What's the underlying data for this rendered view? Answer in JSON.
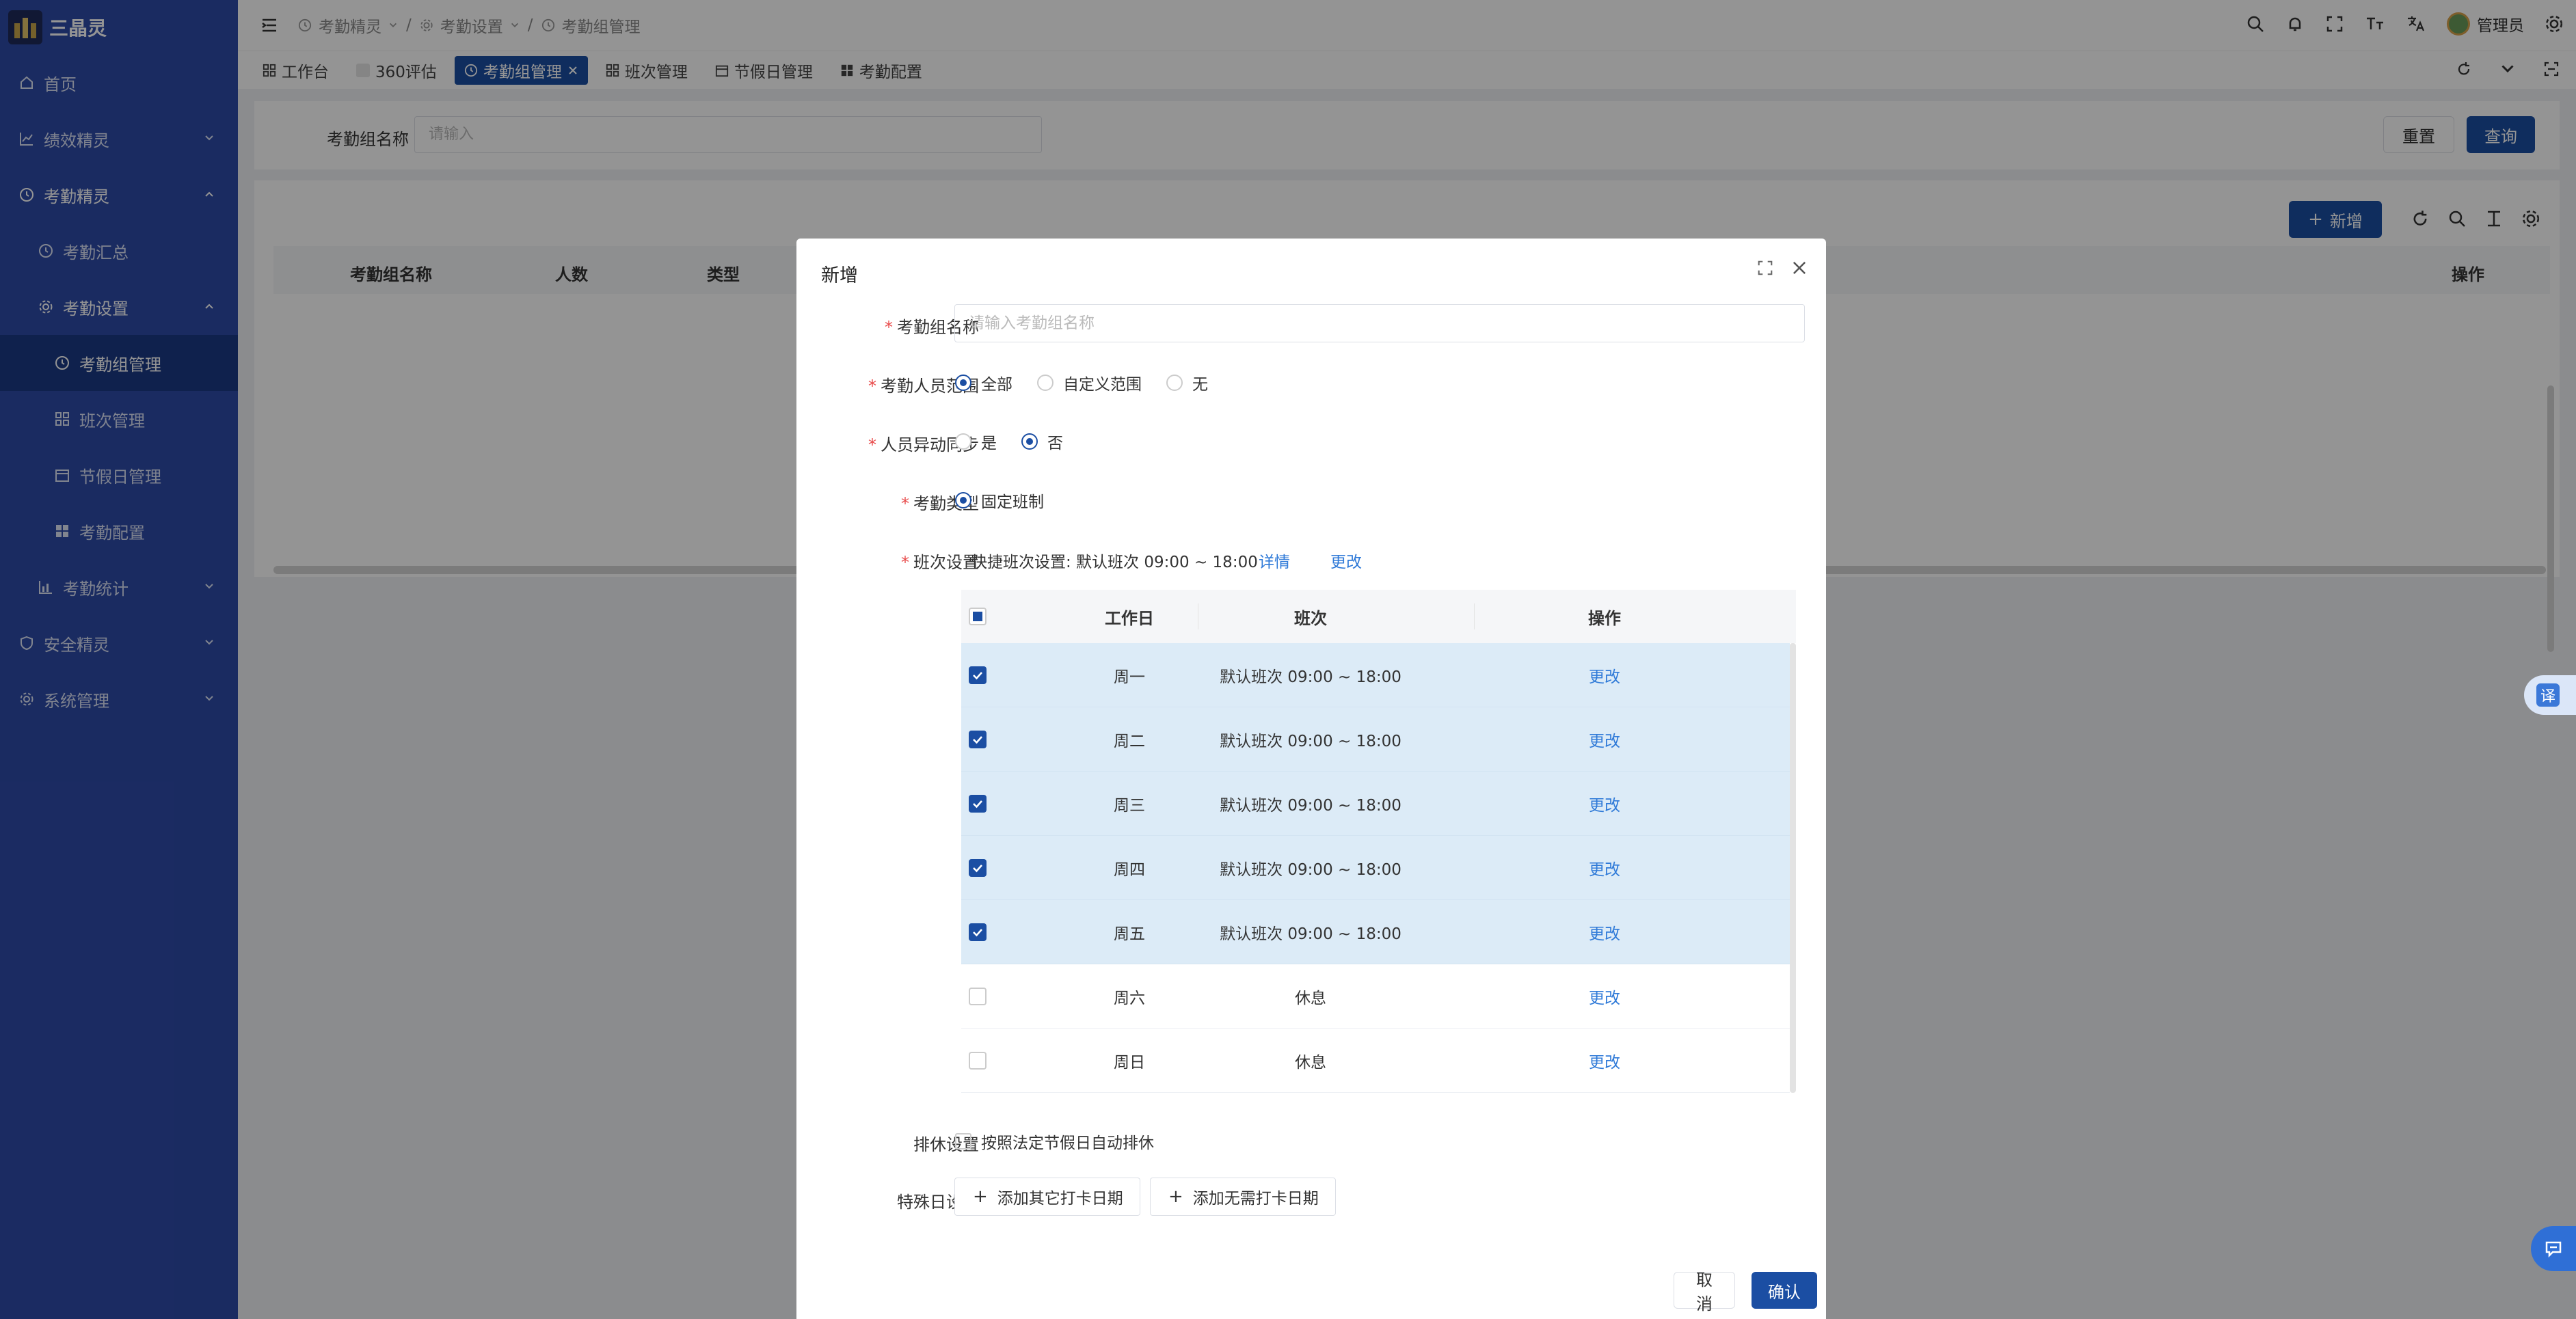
{
  "app": {
    "name": "三晶灵"
  },
  "sidebar": {
    "items": [
      {
        "label": "首页"
      },
      {
        "label": "绩效精灵"
      },
      {
        "label": "考勤精灵"
      },
      {
        "label": "考勤汇总"
      },
      {
        "label": "考勤设置"
      },
      {
        "label": "考勤组管理"
      },
      {
        "label": "班次管理"
      },
      {
        "label": "节假日管理"
      },
      {
        "label": "考勤配置"
      },
      {
        "label": "考勤统计"
      },
      {
        "label": "安全精灵"
      },
      {
        "label": "系统管理"
      }
    ]
  },
  "header": {
    "breadcrumb": [
      "考勤精灵",
      "考勤设置",
      "考勤组管理"
    ],
    "user": "管理员"
  },
  "tabs": [
    {
      "label": "工作台"
    },
    {
      "label": "360评估"
    },
    {
      "label": "考勤组管理"
    },
    {
      "label": "班次管理"
    },
    {
      "label": "节假日管理"
    },
    {
      "label": "考勤配置"
    }
  ],
  "search": {
    "label": "考勤组名称",
    "placeholder": "请输入",
    "reset": "重置",
    "query": "查询"
  },
  "list": {
    "add": "新增",
    "columns": [
      "考勤组名称",
      "人数",
      "类型",
      "操作"
    ]
  },
  "modal": {
    "title": "新增",
    "name_label": "考勤组名称",
    "name_placeholder": "请输入考勤组名称",
    "scope_label": "考勤人员范围",
    "scope_options": [
      "全部",
      "自定义范围",
      "无"
    ],
    "scope_selected": "全部",
    "sync_label": "人员异动同步",
    "sync_options": [
      "是",
      "否"
    ],
    "sync_selected": "否",
    "type_label": "考勤类型",
    "type_option": "固定班制",
    "shift_label": "班次设置",
    "quick_shift": "快捷班次设置: 默认班次 09:00 ~ 18:00",
    "details_link": "详情",
    "change_link": "更改",
    "table": {
      "headers": [
        "工作日",
        "班次",
        "操作"
      ],
      "rows": [
        {
          "day": "周一",
          "shift": "默认班次 09:00 ~ 18:00",
          "op": "更改",
          "checked": true
        },
        {
          "day": "周二",
          "shift": "默认班次 09:00 ~ 18:00",
          "op": "更改",
          "checked": true
        },
        {
          "day": "周三",
          "shift": "默认班次 09:00 ~ 18:00",
          "op": "更改",
          "checked": true
        },
        {
          "day": "周四",
          "shift": "默认班次 09:00 ~ 18:00",
          "op": "更改",
          "checked": true
        },
        {
          "day": "周五",
          "shift": "默认班次 09:00 ~ 18:00",
          "op": "更改",
          "checked": true
        },
        {
          "day": "周六",
          "shift": "休息",
          "op": "更改",
          "checked": false
        },
        {
          "day": "周日",
          "shift": "休息",
          "op": "更改",
          "checked": false
        }
      ]
    },
    "rest_label": "排休设置",
    "rest_option": "按照法定节假日自动排休",
    "special_label": "特殊日设置",
    "add_other": "添加其它打卡日期",
    "add_no_need": "添加无需打卡日期",
    "cancel": "取消",
    "confirm": "确认"
  },
  "float": {
    "translate": "译"
  },
  "colors": {
    "sidebar": "#2e4aa8",
    "primary": "#1b4ea3",
    "link": "#2f7ad8",
    "selected_row": "#dcebf7"
  }
}
